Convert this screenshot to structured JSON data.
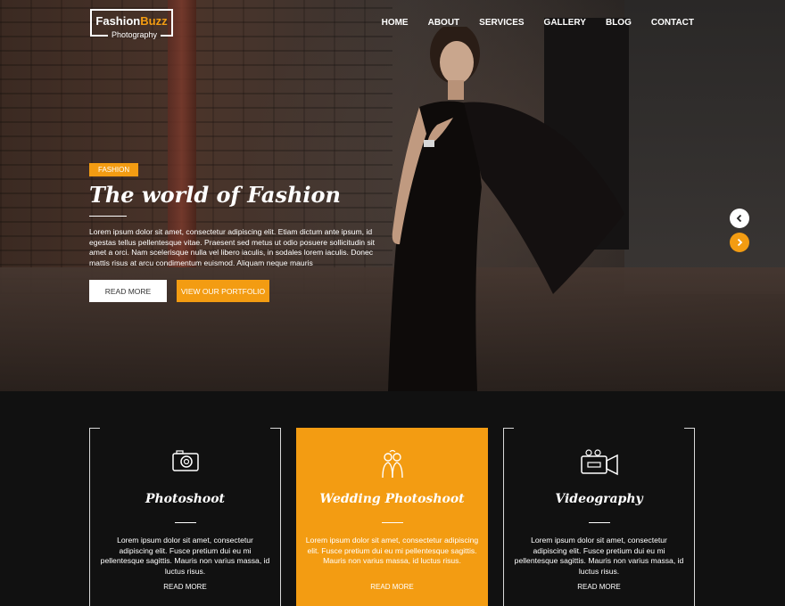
{
  "header": {
    "logo_part1": "Fashion",
    "logo_part2": "Buzz",
    "logo_sub": "Photography",
    "nav": [
      "HOME",
      "ABOUT",
      "SERVICES",
      "GALLERY",
      "BLOG",
      "CONTACT"
    ]
  },
  "hero": {
    "tag": "FASHION",
    "title": "The world of Fashion",
    "text": "Lorem ipsum dolor sit amet, consectetur adipiscing elit. Etiam dictum ante ipsum, id egestas tellus pellentesque vitae. Praesent sed metus ut odio posuere sollicitudin sit amet a orci. Nam scelerisque nulla vel libero iaculis, in sodales lorem iaculis. Donec mattis risus at arcu condimentum euismod. Aliquam neque mauris",
    "btn_read": "READ MORE",
    "btn_portfolio": "VIEW OUR PORTFOLIO",
    "prev_icon": "chevron-left-icon",
    "next_icon": "chevron-right-icon"
  },
  "services": [
    {
      "icon": "camera-icon",
      "title": "Photoshoot",
      "text": "Lorem ipsum dolor sit amet, consectetur adipiscing elit. Fusce pretium dui eu mi pellentesque sagittis. Mauris non varius massa, id luctus risus.",
      "link": "READ MORE"
    },
    {
      "icon": "wedding-couple-icon",
      "title": "Wedding Photoshoot",
      "text": "Lorem ipsum dolor sit amet, consectetur adipiscing elit. Fusce pretium dui eu mi pellentesque sagittis. Mauris non varius massa, id luctus risus.",
      "link": "READ MORE"
    },
    {
      "icon": "video-camera-icon",
      "title": "Videography",
      "text": "Lorem ipsum dolor sit amet, consectetur adipiscing elit. Fusce pretium dui eu mi pellentesque sagittis. Mauris non varius massa, id luctus risus.",
      "link": "READ MORE"
    }
  ],
  "colors": {
    "accent": "#f39c12",
    "background_dark": "#111111",
    "text_light": "#ffffff"
  }
}
